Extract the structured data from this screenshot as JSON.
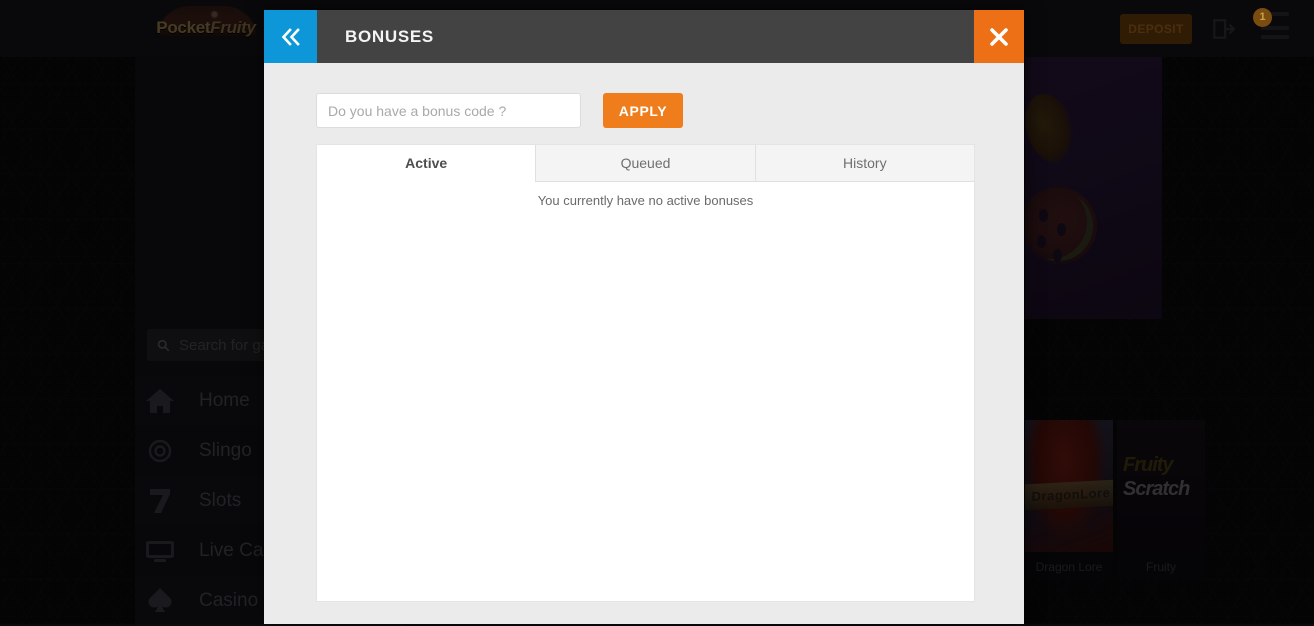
{
  "site": {
    "logo_text_a": "Pocket",
    "logo_text_b": "Fruity",
    "deposit_label": "DEPOSIT",
    "menu_badge": "1",
    "search_placeholder": "Search for games",
    "nav_items": [
      {
        "label": "Home",
        "icon": "home-icon"
      },
      {
        "label": "Slingo",
        "icon": "slingo-icon"
      },
      {
        "label": "Slots",
        "icon": "slots-seven-icon"
      },
      {
        "label": "Live Casino",
        "icon": "live-casino-monitor-icon"
      },
      {
        "label": "Casino",
        "icon": "casino-spade-icon"
      }
    ],
    "tiles": [
      {
        "name": "Dragon Lore",
        "art_label": "DragonLore"
      },
      {
        "name": "Fruity",
        "art_label_a": "Fruity",
        "art_label_b": "Scratch"
      }
    ]
  },
  "modal": {
    "title": "BONUSES",
    "back_icon": "double-chevron-left-icon",
    "close_icon": "close-x-icon",
    "bonus_code": {
      "value": "",
      "placeholder": "Do you have a bonus code ?",
      "apply_label": "APPLY"
    },
    "tabs": [
      {
        "label": "Active",
        "active": true
      },
      {
        "label": "Queued",
        "active": false
      },
      {
        "label": "History",
        "active": false
      }
    ],
    "empty_message": "You currently have no active bonuses"
  },
  "colors": {
    "accent_orange": "#ef7d1c",
    "back_blue": "#0d96d8",
    "close_orange": "#ed7016",
    "header_gray": "#434343",
    "modal_bg": "#ebebeb"
  }
}
